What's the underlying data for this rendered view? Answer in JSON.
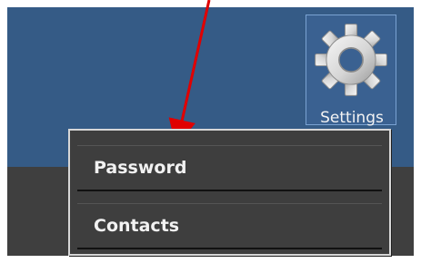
{
  "header": {
    "settings_label": "Settings",
    "settings_icon": "gear-icon",
    "background_color": "#355b86"
  },
  "dropdown": {
    "items": [
      {
        "label": "Password"
      },
      {
        "label": "Contacts"
      }
    ]
  },
  "annotation": {
    "arrow_color": "#e00000"
  }
}
